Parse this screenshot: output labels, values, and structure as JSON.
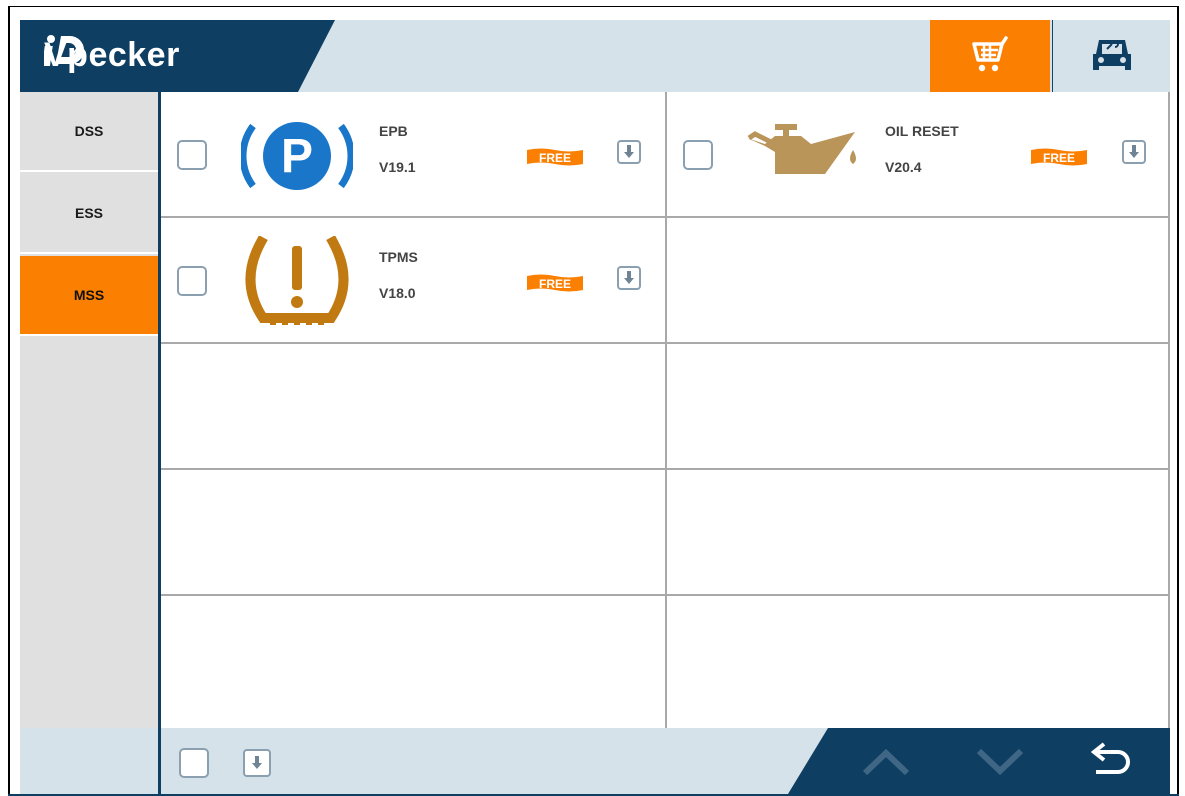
{
  "app": {
    "brand": "Vpecker"
  },
  "header": {
    "cart_icon": "shopping-cart-icon",
    "car_icon": "car-service-icon"
  },
  "sidebar": {
    "items": [
      {
        "label": "DSS",
        "active": false
      },
      {
        "label": "ESS",
        "active": false
      },
      {
        "label": "MSS",
        "active": true
      }
    ]
  },
  "software": {
    "items": [
      {
        "name": "EPB",
        "version": "V19.1",
        "badge": "FREE",
        "icon": "parking-brake-icon",
        "checked": false
      },
      {
        "name": "OIL RESET",
        "version": "V20.4",
        "badge": "FREE",
        "icon": "oil-can-icon",
        "checked": false
      },
      {
        "name": "TPMS",
        "version": "V18.0",
        "badge": "FREE",
        "icon": "tire-pressure-icon",
        "checked": false
      }
    ]
  },
  "footer": {
    "select_all_checked": false,
    "icons": [
      "download-icon",
      "arrow-up-icon",
      "arrow-down-icon",
      "back-icon"
    ]
  },
  "colors": {
    "navy": "#0e3e62",
    "orange": "#fb7f00",
    "light_blue_grey": "#d5e2e9",
    "epb_blue": "#1a76c9",
    "tpms_amber": "#c17a12",
    "oil_tan": "#b9955a"
  }
}
